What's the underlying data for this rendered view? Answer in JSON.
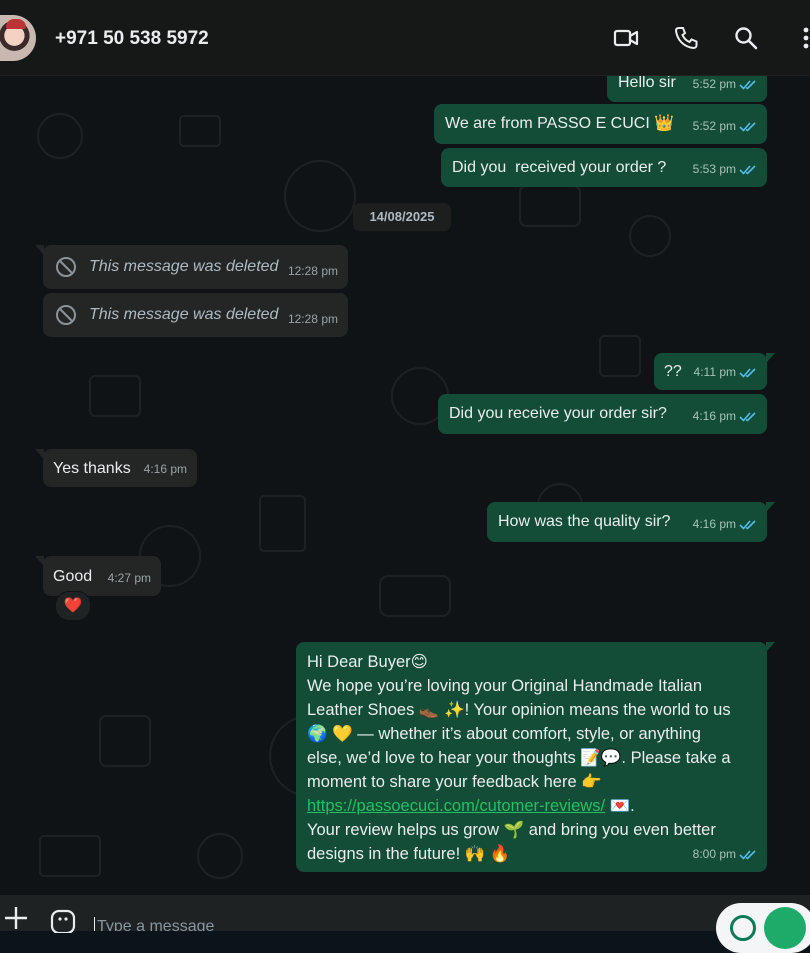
{
  "header": {
    "contact": "+971 50 538 5972",
    "icons": [
      "video-call-icon",
      "voice-call-icon",
      "search-icon",
      "more-options-icon"
    ]
  },
  "chat": {
    "date_chip": "14/08/2025",
    "messages": [
      {
        "dir": "out",
        "text": "Hello sir",
        "time": "5:52 pm"
      },
      {
        "dir": "out",
        "text": "We are from PASSO E CUCI 👑",
        "time": "5:52 pm"
      },
      {
        "dir": "out",
        "text": "Did you  received your order ?",
        "time": "5:53 pm"
      },
      {
        "dir": "in",
        "text": "This message was deleted",
        "time": "12:28 pm"
      },
      {
        "dir": "in",
        "text": "This message was deleted",
        "time": "12:28 pm"
      },
      {
        "dir": "out",
        "text": "??",
        "time": "4:11 pm"
      },
      {
        "dir": "out",
        "text": "Did you receive your order sir?",
        "time": "4:16 pm"
      },
      {
        "dir": "in",
        "text": "Yes thanks",
        "time": "4:16 pm"
      },
      {
        "dir": "out",
        "text": "How was the quality sir?",
        "time": "4:16 pm"
      },
      {
        "dir": "in",
        "text": "Good",
        "time": "4:27 pm",
        "reaction": "❤️"
      },
      {
        "dir": "out",
        "time": "8:00 pm",
        "lines": [
          "Hi Dear Buyer😊",
          "We hope you’re loving your Original Handmade Italian",
          "Leather Shoes 👞 ✨! Your opinion means the world to us",
          "🌍 💛 — whether it’s about comfort, style, or anything",
          "else, we’d love to hear your thoughts 📝💬. Please take a",
          "moment to share your feedback here 👉",
          "LINK",
          "Your review helps us grow 🌱 and bring you even better",
          "designs in the future! 🙌 🔥"
        ],
        "link": "https://passoecuci.com/cutomer-reviews/",
        "after_link": " 💌."
      }
    ]
  },
  "composer": {
    "placeholder": "Type a message"
  },
  "colors": {
    "outgoing": "#144d37",
    "incoming": "#242626",
    "read_ticks": "#53bdeb",
    "accent": "#21c063"
  }
}
